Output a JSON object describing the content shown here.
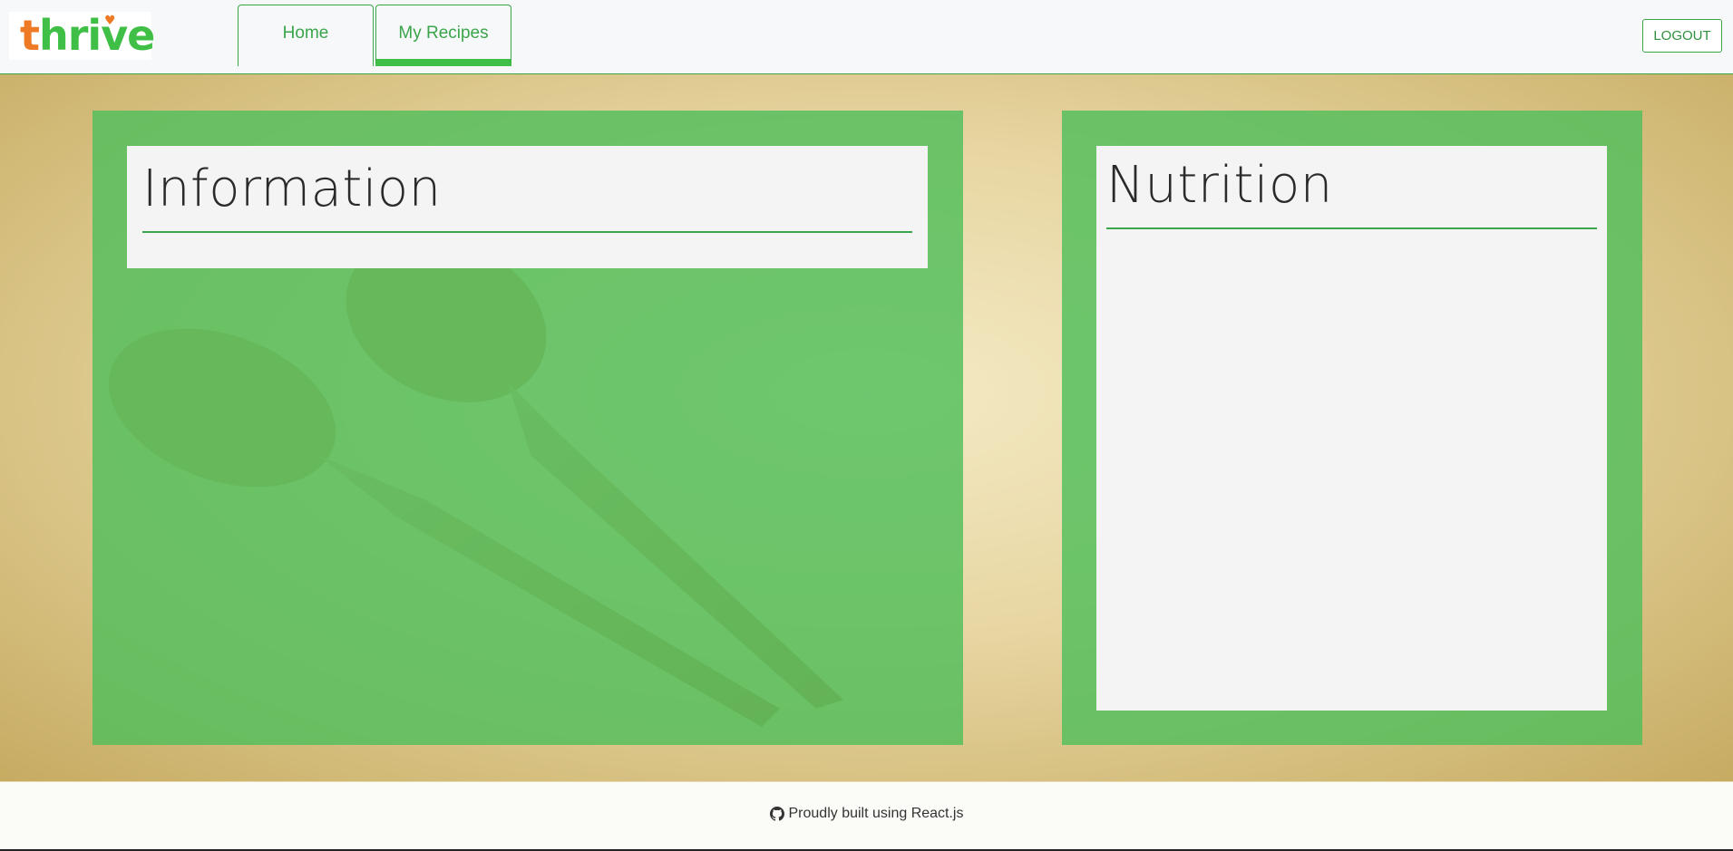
{
  "brand": {
    "logo_text_a": "t",
    "logo_text_b": "hrive",
    "colors": {
      "orange": "#ef7a25",
      "green": "#3fbf45",
      "accent": "#3aa54a"
    }
  },
  "nav": {
    "tabs": [
      {
        "label": "Home",
        "active": false
      },
      {
        "label": "My Recipes",
        "active": true
      }
    ],
    "logout_label": "LOGOUT"
  },
  "main": {
    "information": {
      "title": "Information"
    },
    "nutrition": {
      "title": "Nutrition"
    }
  },
  "footer": {
    "icon": "github-icon",
    "text": "Proudly built using React.js"
  }
}
